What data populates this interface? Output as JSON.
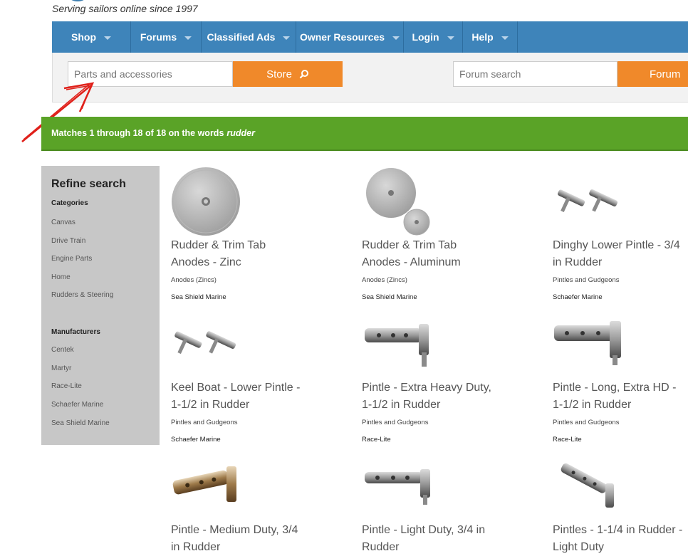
{
  "header": {
    "tagline": "Serving sailors online since 1997"
  },
  "nav": {
    "items": [
      {
        "label": "Shop"
      },
      {
        "label": "Forums"
      },
      {
        "label": "Classified Ads"
      },
      {
        "label": "Owner Resources"
      },
      {
        "label": "Login"
      },
      {
        "label": "Help"
      }
    ]
  },
  "search": {
    "store_placeholder": "Parts and accessories",
    "store_button": "Store",
    "forum_placeholder": "Forum search",
    "forum_button": "Forum"
  },
  "results": {
    "prefix": "Matches 1 through 18 of 18 on the words",
    "term": "rudder"
  },
  "sidebar": {
    "title": "Refine search",
    "categories_heading": "Categories",
    "categories": [
      "Canvas",
      "Drive Train",
      "Engine Parts",
      "Home",
      "Rudders & Steering"
    ],
    "manufacturers_heading": "Manufacturers",
    "manufacturers": [
      "Centek",
      "Martyr",
      "Race-Lite",
      "Schaefer Marine",
      "Sea Shield Marine"
    ]
  },
  "products": [
    {
      "title": "Rudder & Trim Tab Anodes - Zinc",
      "category": "Anodes (Zincs)",
      "manufacturer": "Sea Shield Marine",
      "image": "zinc-anode-disc"
    },
    {
      "title": "Rudder & Trim Tab Anodes - Aluminum",
      "category": "Anodes (Zincs)",
      "manufacturer": "Sea Shield Marine",
      "image": "aluminum-anode-discs"
    },
    {
      "title": "Dinghy Lower Pintle - 3/4 in Rudder",
      "category": "Pintles and Gudgeons",
      "manufacturer": "Schaefer Marine",
      "image": "dinghy-pintle-pair"
    },
    {
      "title": "Keel Boat - Lower Pintle - 1-1/2 in Rudder",
      "category": "Pintles and Gudgeons",
      "manufacturer": "Schaefer Marine",
      "image": "keelboat-pintle-pair"
    },
    {
      "title": "Pintle - Extra Heavy Duty, 1-1/2 in Rudder",
      "category": "Pintles and Gudgeons",
      "manufacturer": "Race-Lite",
      "image": "pintle-extra-heavy"
    },
    {
      "title": "Pintle - Long, Extra HD - 1-1/2 in Rudder",
      "category": "Pintles and Gudgeons",
      "manufacturer": "Race-Lite",
      "image": "pintle-long-extra-hd"
    },
    {
      "title": "Pintle - Medium Duty, 3/4 in Rudder",
      "category": "",
      "manufacturer": "",
      "image": "pintle-medium-duty"
    },
    {
      "title": "Pintle - Light Duty, 3/4 in Rudder",
      "category": "",
      "manufacturer": "",
      "image": "pintle-light-duty"
    },
    {
      "title": "Pintles - 1-1/4 in Rudder - Light Duty",
      "category": "",
      "manufacturer": "",
      "image": "pintles-light-duty"
    }
  ],
  "colors": {
    "nav": "#3e84ba",
    "orange": "#f0892a",
    "green": "#5aa327",
    "sidebar": "#c7c7c7",
    "annotation": "#e0201a"
  }
}
